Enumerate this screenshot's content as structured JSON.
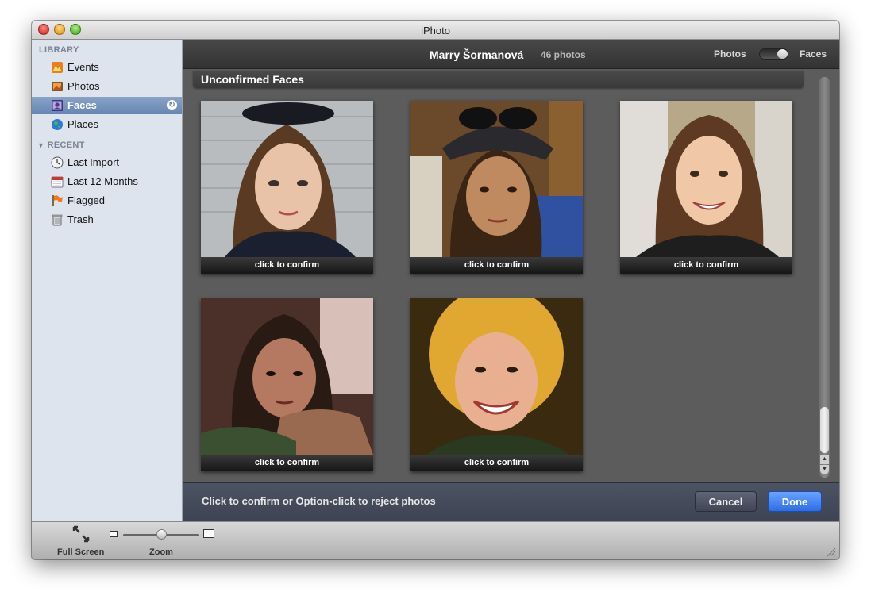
{
  "window": {
    "title": "iPhoto"
  },
  "sidebar": {
    "library_header": "LIBRARY",
    "recent_header": "RECENT",
    "library_items": [
      {
        "label": "Events",
        "icon": "events-icon"
      },
      {
        "label": "Photos",
        "icon": "photos-icon"
      },
      {
        "label": "Faces",
        "icon": "faces-icon",
        "selected": true
      },
      {
        "label": "Places",
        "icon": "places-icon"
      }
    ],
    "recent_items": [
      {
        "label": "Last Import",
        "icon": "last-import-icon"
      },
      {
        "label": "Last 12 Months",
        "icon": "calendar-icon"
      },
      {
        "label": "Flagged",
        "icon": "flag-icon"
      },
      {
        "label": "Trash",
        "icon": "trash-icon"
      }
    ]
  },
  "header": {
    "name": "Marry Šormanová",
    "count": "46 photos",
    "toggle_left": "Photos",
    "toggle_right": "Faces",
    "toggle_state": "Faces"
  },
  "section": {
    "title": "Unconfirmed Faces"
  },
  "faces": [
    {
      "caption": "click to confirm"
    },
    {
      "caption": "click to confirm"
    },
    {
      "caption": "click to confirm"
    },
    {
      "caption": "click to confirm"
    },
    {
      "caption": "click to confirm"
    }
  ],
  "bottom": {
    "hint": "Click to confirm or Option-click to reject photos",
    "cancel": "Cancel",
    "done": "Done"
  },
  "footer": {
    "fullscreen": "Full Screen",
    "zoom": "Zoom"
  },
  "colors": {
    "accent": "#2a6ee8",
    "sidebar_bg": "#dee4ee",
    "content_bg": "#5c5c5c"
  }
}
